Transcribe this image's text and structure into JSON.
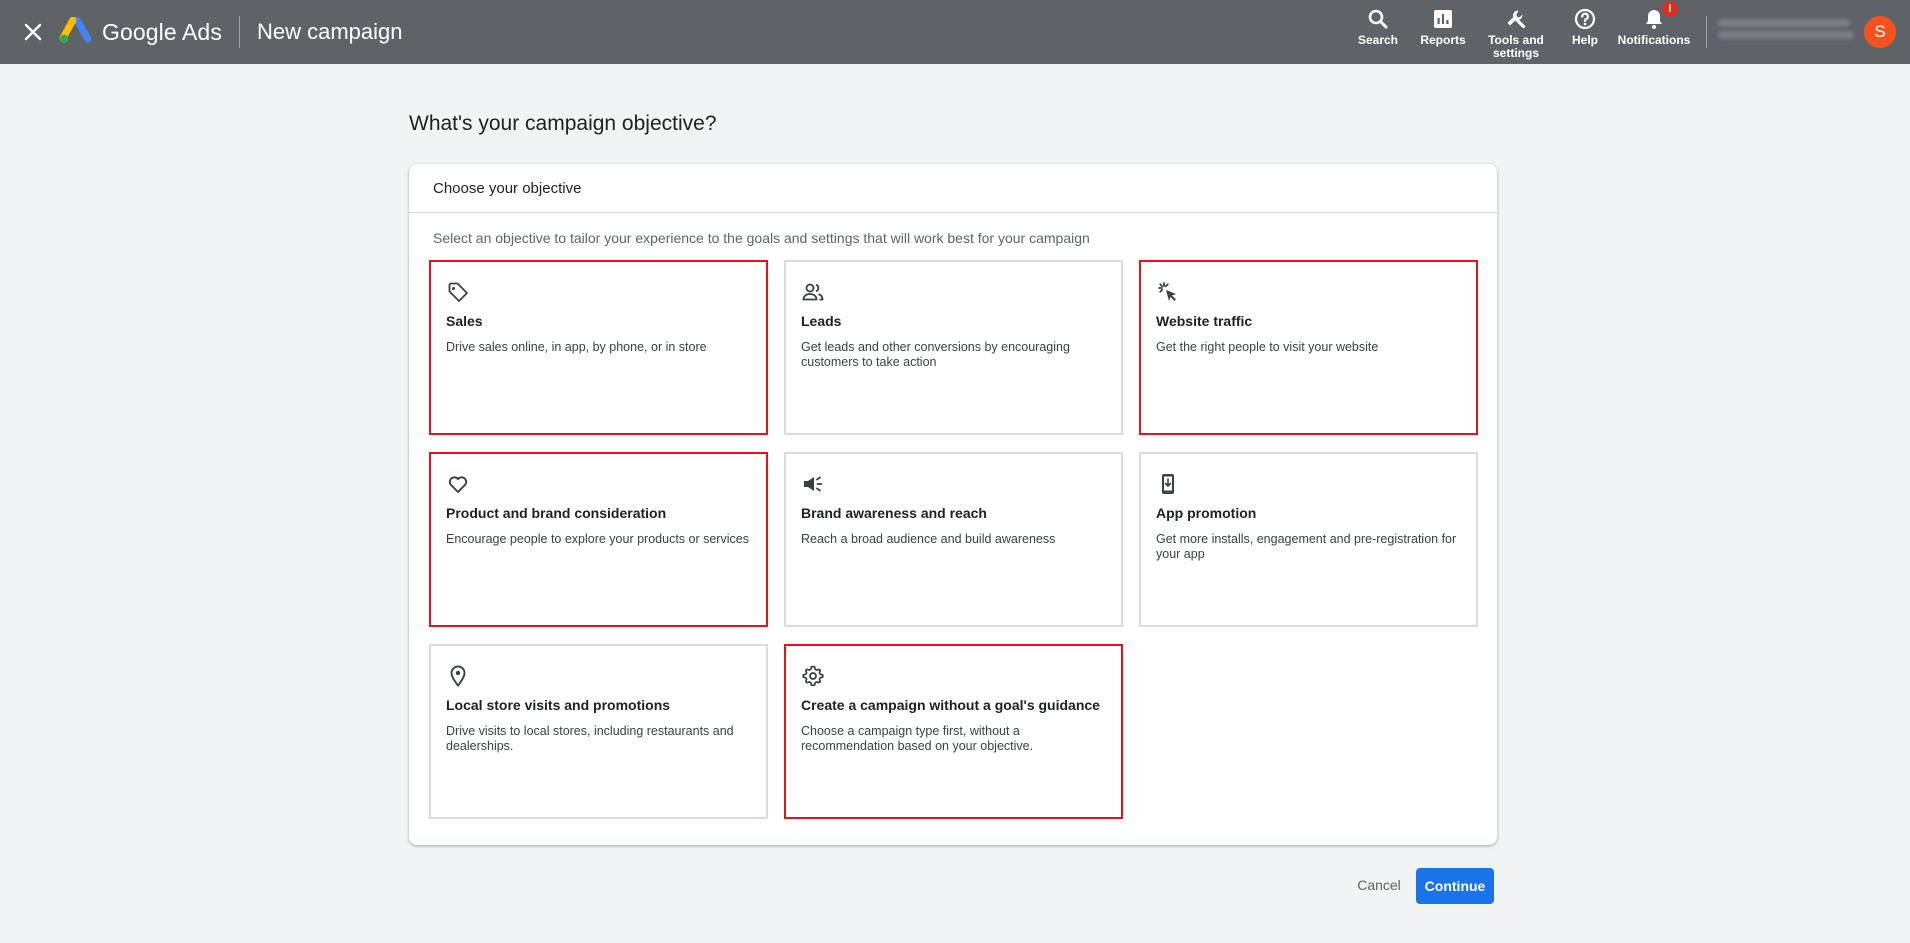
{
  "header": {
    "brand": "Google Ads",
    "page_name": "New campaign",
    "tools": [
      {
        "label": "Search",
        "icon": "search-icon"
      },
      {
        "label": "Reports",
        "icon": "reports-icon"
      },
      {
        "label": "Tools and settings",
        "icon": "wrench-icon"
      },
      {
        "label": "Help",
        "icon": "help-icon"
      },
      {
        "label": "Notifications",
        "icon": "bell-icon"
      }
    ],
    "notification_badge": "!",
    "avatar_initial": "S"
  },
  "main": {
    "title": "What's your campaign objective?",
    "card_header": "Choose your objective",
    "card_subtitle": "Select an objective to tailor your experience to the goals and settings that will work best for your campaign",
    "objectives": [
      {
        "title": "Sales",
        "description": "Drive sales online, in app, by phone, or in store",
        "icon": "tag-icon"
      },
      {
        "title": "Leads",
        "description": "Get leads and other conversions by encouraging customers to take action",
        "icon": "people-icon"
      },
      {
        "title": "Website traffic",
        "description": "Get the right people to visit your website",
        "icon": "cursor-click-icon"
      },
      {
        "title": "Product and brand consideration",
        "description": "Encourage people to explore your products or services",
        "icon": "heart-icon"
      },
      {
        "title": "Brand awareness and reach",
        "description": "Reach a broad audience and build awareness",
        "icon": "megaphone-icon"
      },
      {
        "title": "App promotion",
        "description": "Get more installs, engagement and pre-registration for your app",
        "icon": "phone-download-icon"
      },
      {
        "title": "Local store visits and promotions",
        "description": "Drive visits to local stores, including restaurants and dealerships.",
        "icon": "location-pin-icon"
      },
      {
        "title": "Create a campaign without a goal's guidance",
        "description": "Choose a campaign type first, without a recommendation based on your objective.",
        "icon": "gear-icon"
      }
    ]
  },
  "footer": {
    "cancel": "Cancel",
    "continue": "Continue"
  },
  "colors": {
    "topbar": "#5f6368",
    "primary": "#1a73e8",
    "highlight": "#e8131a",
    "avatar": "#f4511e",
    "badge": "#d93025"
  }
}
